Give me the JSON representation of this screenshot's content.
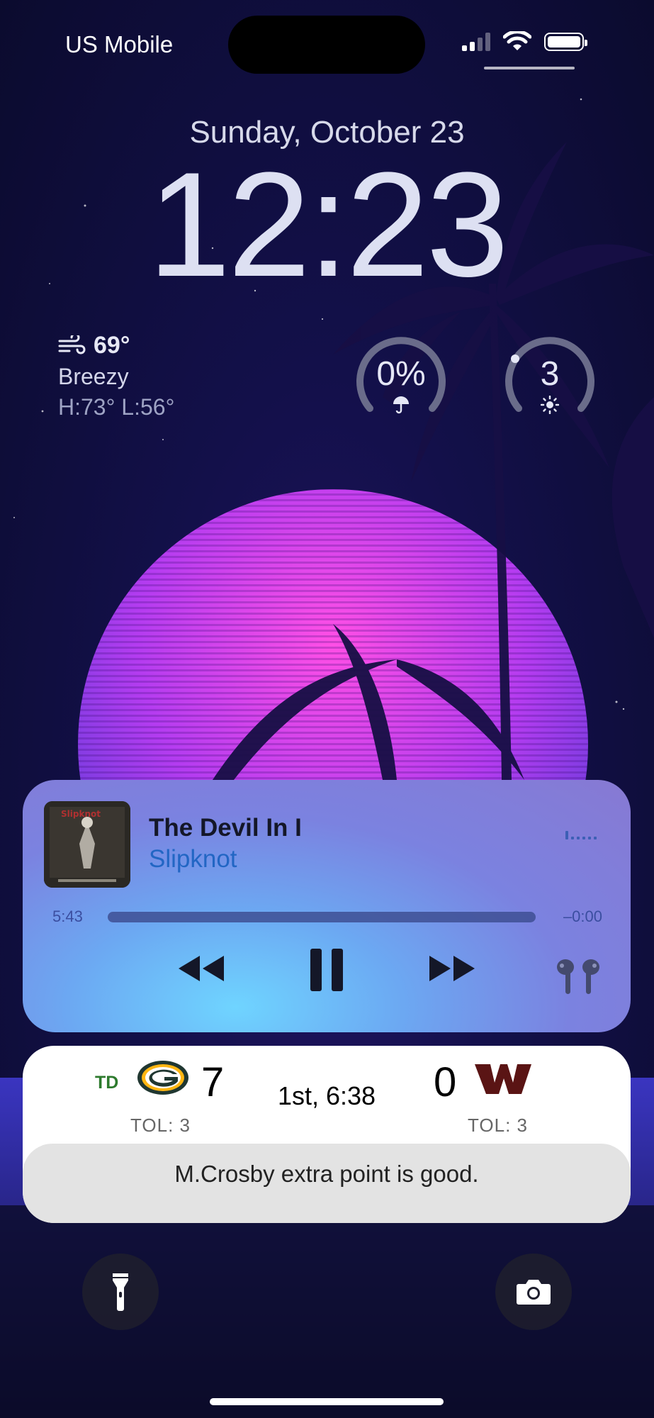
{
  "status_bar": {
    "carrier": "US Mobile"
  },
  "lock_screen": {
    "date": "Sunday, October 23",
    "time": "12:23"
  },
  "widgets": {
    "weather": {
      "icon": "wind-icon",
      "temperature": "69°",
      "condition": "Breezy",
      "high_low": "H:73° L:56°"
    },
    "rain_chance": {
      "value": "0%",
      "icon": "umbrella-icon"
    },
    "uv_index": {
      "value": "3",
      "icon": "sun-icon"
    }
  },
  "now_playing": {
    "song": "The Devil In I",
    "artist": "Slipknot",
    "elapsed": "5:43",
    "remaining": "–0:00",
    "progress": 1.0,
    "album_art_text": "Slipknot"
  },
  "game": {
    "scoring_badge": "TD",
    "home_team": {
      "logo": "packers-g-logo",
      "score": "7",
      "timeouts": "TOL: 3"
    },
    "away_team": {
      "logo": "commanders-w-logo",
      "score": "0",
      "timeouts": "TOL: 3"
    },
    "period": "1st, 6:38",
    "last_play": "M.Crosby extra point is good.",
    "colors": {
      "packers_green": "#203731",
      "packers_gold": "#FFB612",
      "commanders": "#5A1414"
    }
  },
  "controls": {
    "flashlight": "flashlight-icon",
    "camera": "camera-icon"
  }
}
